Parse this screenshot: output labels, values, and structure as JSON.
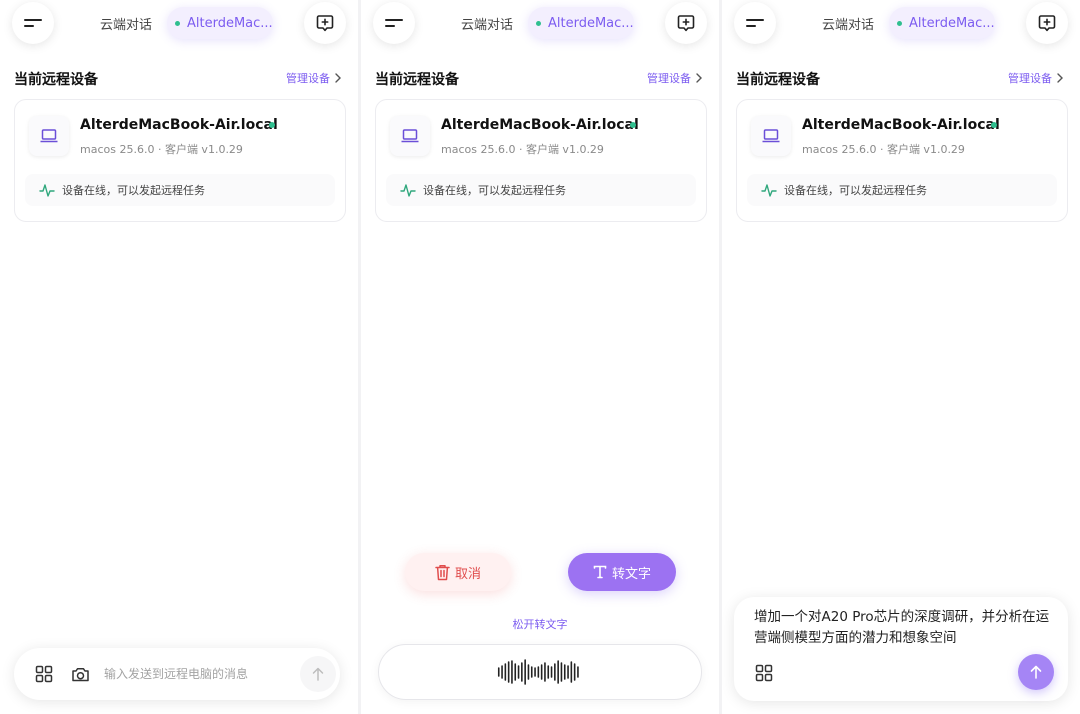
{
  "panels": [
    {
      "topbar": {
        "cloud_tab": "云端对话",
        "remote_tab": "AlterdeMac..."
      },
      "section": {
        "title": "当前远程设备",
        "manage": "管理设备"
      },
      "device": {
        "name": "AlterdeMacBook-Air.local",
        "meta": "macos 25.6.0 · 客户端 v1.0.29",
        "status": "设备在线，可以发起远程任务"
      },
      "input": {
        "placeholder": "输入发送到远程电脑的消息"
      }
    },
    {
      "topbar": {
        "cloud_tab": "云端对话",
        "remote_tab": "AlterdeMac..."
      },
      "section": {
        "title": "当前远程设备",
        "manage": "管理设备"
      },
      "device": {
        "name": "AlterdeMacBook-Air.local",
        "meta": "macos 25.6.0 · 客户端 v1.0.29",
        "status": "设备在线，可以发起远程任务"
      },
      "voice": {
        "cancel": "取消",
        "to_text": "转文字",
        "hint": "松开转文字"
      }
    },
    {
      "topbar": {
        "cloud_tab": "云端对话",
        "remote_tab": "AlterdeMac..."
      },
      "section": {
        "title": "当前远程设备",
        "manage": "管理设备"
      },
      "device": {
        "name": "AlterdeMacBook-Air.local",
        "meta": "macos 25.6.0 · 客户端 v1.0.29",
        "status": "设备在线，可以发起远程任务"
      },
      "composer": {
        "text": "增加一个对A20 Pro芯片的深度调研，并分析在运营端侧模型方面的潜力和想象空间"
      }
    }
  ],
  "icons": {
    "menu": "menu-icon",
    "compose": "new-chat-icon",
    "laptop": "laptop-icon",
    "activity": "activity-icon",
    "grid": "grid-icon",
    "camera": "camera-icon",
    "send": "arrow-up-icon",
    "trash": "trash-icon",
    "text": "text-icon",
    "chevron": "chevron-right-icon"
  },
  "colors": {
    "accent": "#7c5cf0",
    "online": "#2fbf8f",
    "danger": "#e04d4d",
    "accent_button": "#9c72f2"
  }
}
